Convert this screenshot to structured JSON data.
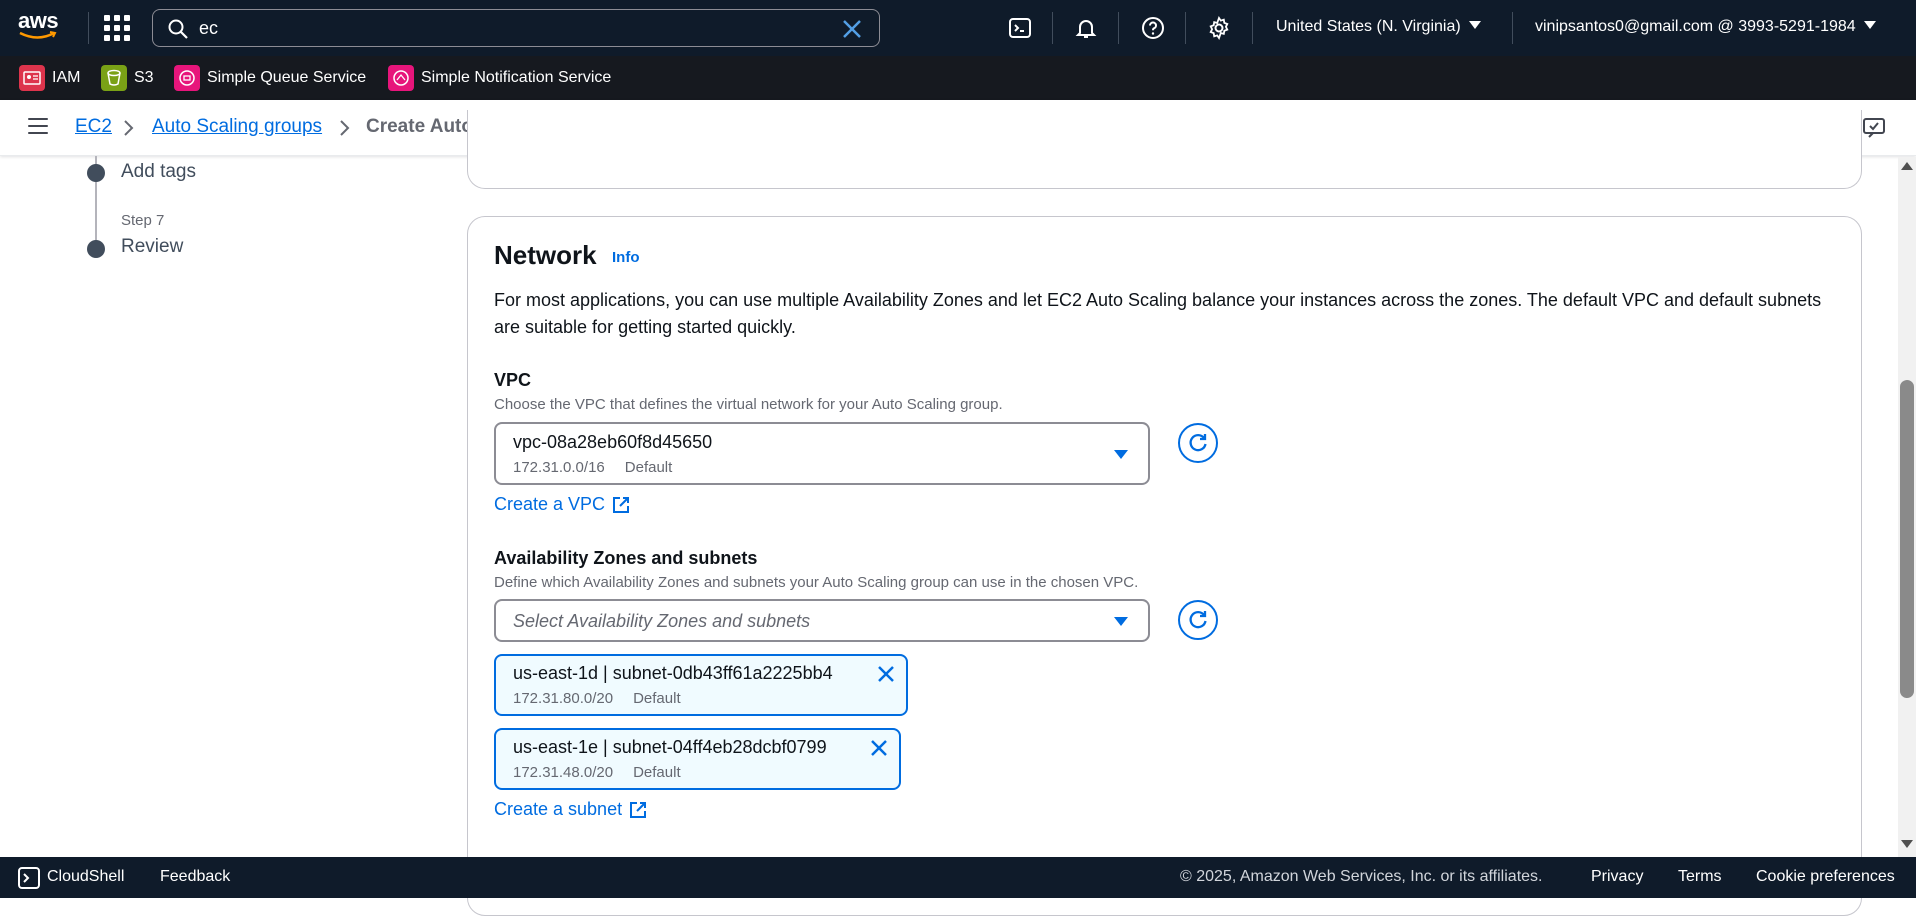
{
  "topnav": {
    "logo_text": "aws",
    "search_value": "ec",
    "region": "United States (N. Virginia)",
    "account": "vinipsantos0@gmail.com @ 3993-5291-1984"
  },
  "favorites": [
    {
      "label": "IAM",
      "color": "#dd344c",
      "icon": "iam-icon"
    },
    {
      "label": "S3",
      "color": "#7aa116",
      "icon": "s3-icon"
    },
    {
      "label": "Simple Queue Service",
      "color": "#e7157b",
      "icon": "sqs-icon"
    },
    {
      "label": "Simple Notification Service",
      "color": "#e7157b",
      "icon": "sns-icon"
    }
  ],
  "breadcrumb": {
    "items": [
      "EC2",
      "Auto Scaling groups"
    ],
    "current": "Create Auto Scaling group"
  },
  "steps": {
    "items": [
      {
        "title": "Add tags",
        "number": ""
      },
      {
        "title": "Review",
        "number": "Step 7"
      }
    ]
  },
  "network": {
    "title": "Network",
    "info": "Info",
    "description": "For most applications, you can use multiple Availability Zones and let EC2 Auto Scaling balance your instances across the zones. The default VPC and default subnets are suitable for getting started quickly.",
    "vpc": {
      "label": "VPC",
      "hint": "Choose the VPC that defines the virtual network for your Auto Scaling group.",
      "value": "vpc-08a28eb60f8d45650",
      "cidr": "172.31.0.0/16",
      "tag": "Default",
      "create_link": "Create a VPC"
    },
    "az": {
      "label": "Availability Zones and subnets",
      "hint": "Define which Availability Zones and subnets your Auto Scaling group can use in the chosen VPC.",
      "placeholder": "Select Availability Zones and subnets",
      "tokens": [
        {
          "value": "us-east-1d | subnet-0db43ff61a2225bb4",
          "cidr": "172.31.80.0/20",
          "tag": "Default"
        },
        {
          "value": "us-east-1e | subnet-04ff4eb28dcbf0799",
          "cidr": "172.31.48.0/20",
          "tag": "Default"
        }
      ],
      "create_link": "Create a subnet"
    }
  },
  "footer": {
    "cloudshell": "CloudShell",
    "feedback": "Feedback",
    "copyright": "© 2025, Amazon Web Services, Inc. or its affiliates.",
    "privacy": "Privacy",
    "terms": "Terms",
    "cookies": "Cookie preferences"
  },
  "colors": {
    "nav_bg": "#0f1b2a",
    "link": "#006ce0",
    "token_bg": "#f0fbff"
  }
}
